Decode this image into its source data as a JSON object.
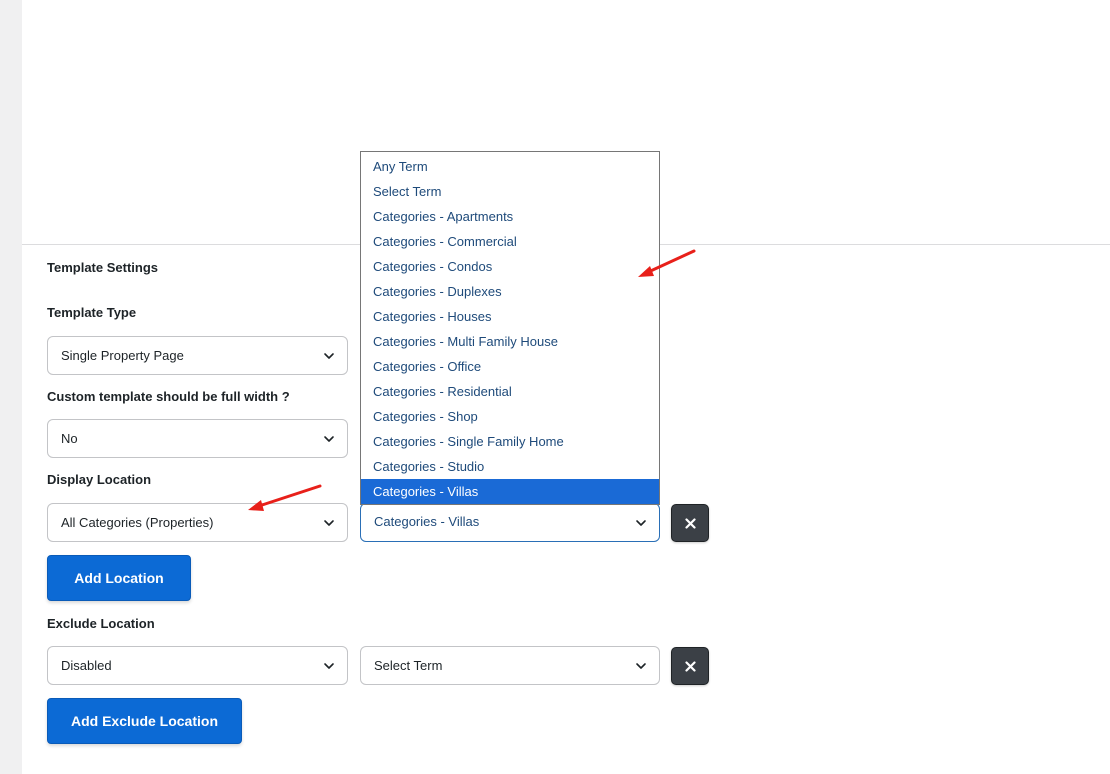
{
  "settings": {
    "section_title": "Template Settings",
    "template_type": {
      "label": "Template Type",
      "value": "Single Property Page"
    },
    "full_width": {
      "label": "Custom template should be full width ?",
      "value": "No"
    },
    "display_location": {
      "label": "Display Location",
      "rule_value": "All Categories (Properties)",
      "term_value": "Categories - Villas",
      "add_button": "Add Location"
    },
    "exclude_location": {
      "label": "Exclude Location",
      "rule_value": "Disabled",
      "term_value": "Select Term",
      "add_button": "Add Exclude Location"
    }
  },
  "term_dropdown": {
    "options": [
      "Any Term",
      "Select Term",
      "Categories - Apartments",
      "Categories - Commercial",
      "Categories - Condos",
      "Categories - Duplexes",
      "Categories - Houses",
      "Categories - Multi Family House",
      "Categories - Office",
      "Categories - Residential",
      "Categories - Shop",
      "Categories - Single Family Home",
      "Categories - Studio",
      "Categories - Villas"
    ],
    "selected_index": 13
  },
  "colors": {
    "primary_button": "#0c6ad5",
    "remove_button": "#3b4046",
    "selected_option": "#1a6ad6",
    "annotation_arrow": "#e8201a"
  },
  "icons": {
    "chevron": "chevron-down-icon",
    "remove": "close-icon",
    "annotation": "red-arrow"
  }
}
